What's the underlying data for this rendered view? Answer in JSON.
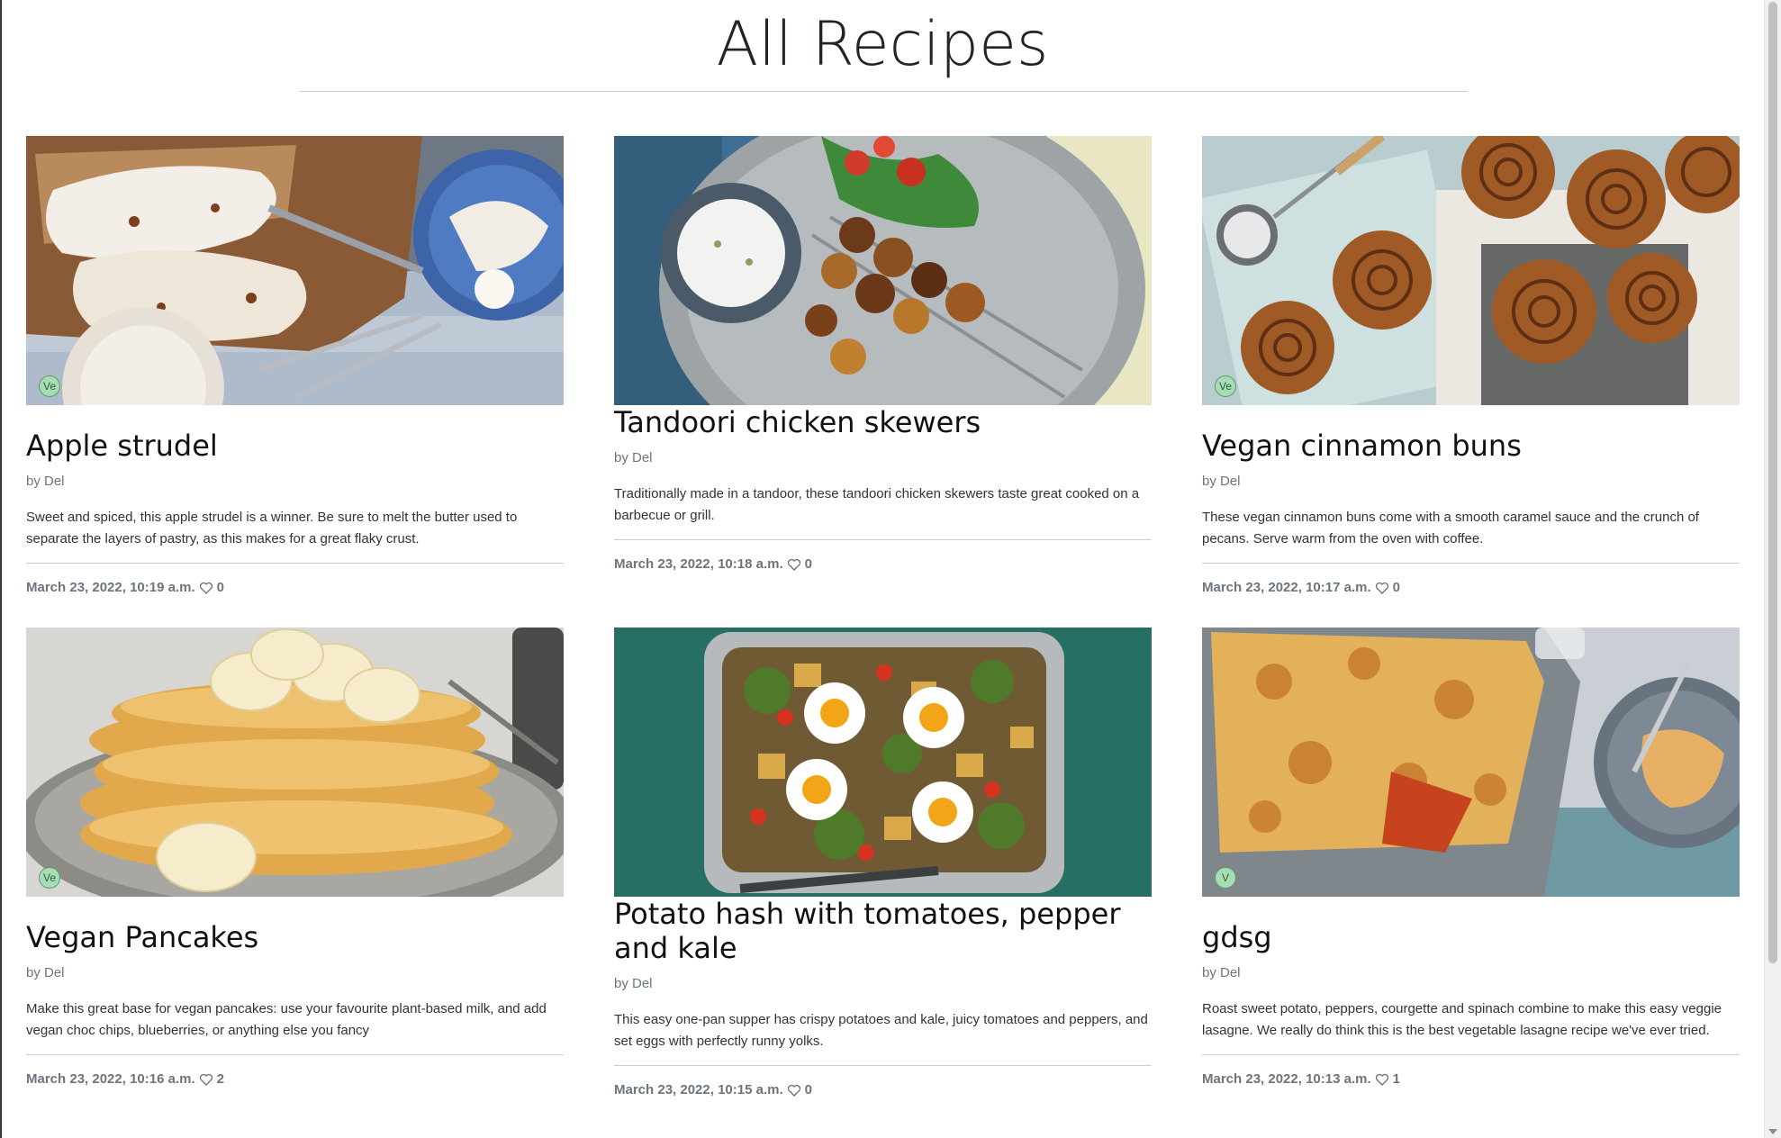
{
  "page": {
    "title": "All Recipes"
  },
  "recipes": [
    {
      "title": "Apple strudel",
      "author": "by Del",
      "description": "Sweet and spiced, this apple strudel is a winner. Be sure to melt the butter used to separate the layers of pastry, as this makes for a great flaky crust.",
      "date": "March 23, 2022, 10:19 a.m.",
      "likes": "0",
      "badge": "Ve",
      "image": "apple-strudel-image"
    },
    {
      "title": "Tandoori chicken skewers",
      "author": "by Del",
      "description": "Traditionally made in a tandoor, these tandoori chicken skewers taste great cooked on a barbecue or grill.",
      "date": "March 23, 2022, 10:18 a.m.",
      "likes": "0",
      "badge": "",
      "image": "tandoori-chicken-image"
    },
    {
      "title": "Vegan cinnamon buns",
      "author": "by Del",
      "description": "These vegan cinnamon buns come with a smooth caramel sauce and the crunch of pecans. Serve warm from the oven with coffee.",
      "date": "March 23, 2022, 10:17 a.m.",
      "likes": "0",
      "badge": "Ve",
      "image": "cinnamon-buns-image"
    },
    {
      "title": "Vegan Pancakes",
      "author": "by Del",
      "description": "Make this great base for vegan pancakes: use your favourite plant-based milk, and add vegan choc chips, blueberries, or anything else you fancy",
      "date": "March 23, 2022, 10:16 a.m.",
      "likes": "2",
      "badge": "Ve",
      "image": "pancakes-image"
    },
    {
      "title": "Potato hash with tomatoes, pepper and kale",
      "author": "by Del",
      "description": "This easy one-pan supper has crispy potatoes and kale, juicy tomatoes and peppers, and set eggs with perfectly runny yolks.",
      "date": "March 23, 2022, 10:15 a.m.",
      "likes": "0",
      "badge": "",
      "image": "potato-hash-image"
    },
    {
      "title": "gdsg",
      "author": "by Del",
      "description": "Roast sweet potato, peppers, courgette and spinach combine to make this easy veggie lasagne. We really do think this is the best vegetable lasagne recipe we've ever tried.",
      "date": "March 23, 2022, 10:13 a.m.",
      "likes": "1",
      "badge": "V",
      "image": "lasagne-image"
    }
  ]
}
